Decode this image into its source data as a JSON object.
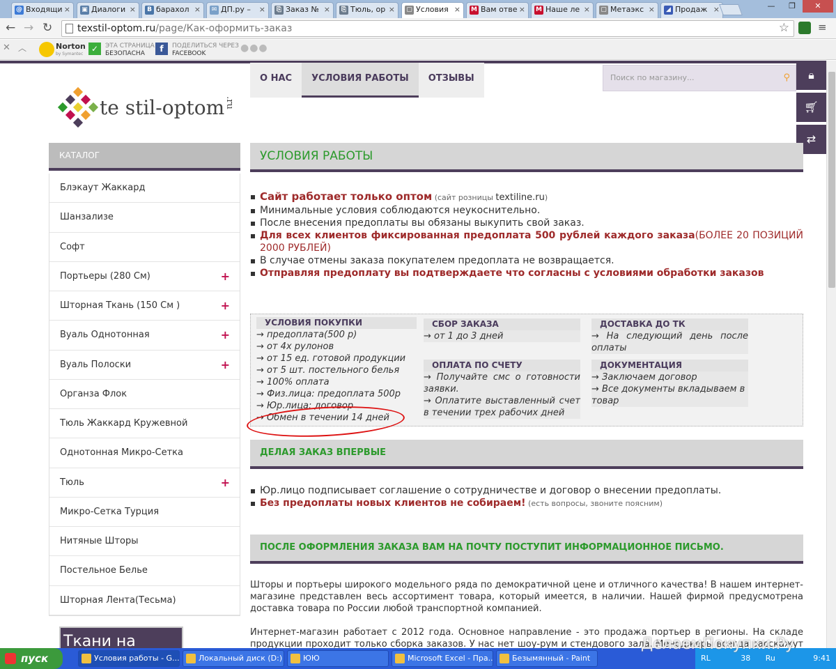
{
  "browser": {
    "tabs": [
      {
        "label": "Входящи",
        "fav": "@",
        "color": "#3d7bd6"
      },
      {
        "label": "Диалоги",
        "fav": "▣",
        "color": "#5b7fa8"
      },
      {
        "label": "барахол",
        "fav": "В",
        "color": "#4a76a8"
      },
      {
        "label": "ДП.ру –",
        "fav": "✉",
        "color": "#7aa0c8"
      },
      {
        "label": "Заказ №",
        "fav": "⎘",
        "color": "#6b7b8c"
      },
      {
        "label": "Тюль, ор",
        "fav": "⎘",
        "color": "#6b7b8c"
      },
      {
        "label": "Условия",
        "fav": "▢",
        "color": "#888888"
      },
      {
        "label": "Вам отве",
        "fav": "M",
        "color": "#c8102e"
      },
      {
        "label": "Наше ле",
        "fav": "M",
        "color": "#c8102e"
      },
      {
        "label": "Метаэкс",
        "fav": "▢",
        "color": "#888888"
      },
      {
        "label": "Продаж",
        "fav": "◢",
        "color": "#3a5bb5"
      }
    ],
    "active_tab_index": 6,
    "url_host": "texstil-optom.ru",
    "url_path": "/page/Как-оформить-заказ",
    "toolbar": {
      "norton_label": "Norton",
      "norton_sub": "by Symantec",
      "safe_line1": "ЭТА СТРАНИЦА",
      "safe_line2": "БЕЗОПАСНА",
      "share_line1": "ПОДЕЛИТЬСЯ ЧЕРЕЗ",
      "share_line2": "FACEBOOK"
    }
  },
  "site": {
    "logo_text": "te  stil-optom",
    "logo_suffix": ".ru",
    "nav": [
      {
        "label": "О НАС",
        "active": false
      },
      {
        "label": "УСЛОВИЯ РАБОТЫ",
        "active": true
      },
      {
        "label": "ОТЗЫВЫ",
        "active": false
      }
    ],
    "search_placeholder": "Поиск по магазину...",
    "catalog_title": "КАТАЛОГ",
    "catalog": [
      {
        "label": "Блэкаут Жаккард",
        "plus": false
      },
      {
        "label": "Шанзализе",
        "plus": false
      },
      {
        "label": "Софт",
        "plus": false
      },
      {
        "label": "Портьеры (280 См)",
        "plus": true
      },
      {
        "label": "Шторная Ткань (150 См )",
        "plus": true
      },
      {
        "label": "Вуаль Однотонная",
        "plus": true
      },
      {
        "label": "Вуаль Полоски",
        "plus": true
      },
      {
        "label": "Органза Флок",
        "plus": false
      },
      {
        "label": "Тюль Жаккард Кружевной",
        "plus": false
      },
      {
        "label": "Однотонная Микро-Сетка",
        "plus": false
      },
      {
        "label": "Тюль",
        "plus": true
      },
      {
        "label": "Микро-Сетка Турция",
        "plus": false
      },
      {
        "label": "Нитяные Шторы",
        "plus": false
      },
      {
        "label": "Постельное Белье",
        "plus": false
      },
      {
        "label": "Шторная Лента(Тесьма)",
        "plus": false
      }
    ],
    "banner_text": "Ткани на заказ"
  },
  "content": {
    "title": "УСЛОВИЯ РАБОТЫ",
    "rules": {
      "r1_bold": "Сайт работает только оптом",
      "r1_small": " (сайт розницы ",
      "r1_link": "textiline.ru",
      "r1_close": ")",
      "r2": "Минимальные условия соблюдаются неукоснительно.",
      "r3": "После внесения предоплаты вы обязаны выкупить свой заказ.",
      "r4_bold": "Для всех клиентов фиксированная предоплата 500 рублей каждого заказа",
      "r4_rest": "(БОЛЕЕ 20 ПОЗИЦИЙ 2000 РУБЛЕЙ)",
      "r5": "В случае отмены заказа покупателем предоплата не возвращается.",
      "r6_bold": "Отправляя предоплату вы подтверждаете что согласны с условиями обработки заказов"
    },
    "purchase_title": "УСЛОВИЯ ПОКУПКИ",
    "purchase_items": [
      "→ предоплата(500 р)",
      "→ от 4х рулонов",
      "→ от 15 ед. готовой продукции",
      "→ от 5 шт. постельного белья",
      "→ 100% оплата",
      "→ Физ.лица: предоплата 500р",
      "→ Юр.лица: договор",
      "→ Обмен в течении 14 дней"
    ],
    "assembly_title": "СБОР ЗАКАЗА",
    "assembly_text": "→ от 1 до 3 дней",
    "invoice_title": "ОПЛАТА ПО СЧЕТУ",
    "invoice_text1": "→ Получайте смс о готовности заявки.",
    "invoice_text2": "→ Оплатите выставленный счет в течении трех рабочих дней",
    "delivery_title": "ДОСТАВКА ДО ТК",
    "delivery_text": "→ На следующий день после оплаты",
    "docs_title": "ДОКУМЕНТАЦИЯ",
    "docs_text1": "→ Заключаем договор",
    "docs_text2": "→ Все документы вкладываем в товар",
    "first_title": "ДЕЛАЯ ЗАКАЗ ВПЕРВЫЕ",
    "first_1": "Юр.лицо подписывает соглашение о сотрудничестве и договор о внесении предоплаты.",
    "first_2_bold": "Без предоплаты новых клиентов не собираем!",
    "first_2_small": " (есть вопросы, звоните поясним)",
    "after_title": "ПОСЛЕ ОФОРМЛЕНИЯ ЗАКАЗА ВАМ НА ПОЧТУ ПОСТУПИТ ИНФОРМАЦИОННОЕ ПИСЬМО.",
    "para1": "Шторы и портьеры широкого модельного ряда по демократичной цене и отличного качества! В нашем интернет-магазине представлен весь ассортимент товара, который имеется, в наличии. Нашей фирмой предусмотрена доставка товара по России любой транспортной компанией.",
    "para2": "Интернет-магазин работает с 2012 года. Основное направление - это продажа портьер в регионы. На складе продукции проходит только сборка заказов. У нас нет шоу-рум и стендового зала. Менеджеры всегда расскажут вам о новых"
  },
  "taskbar": {
    "start": "пуск",
    "tasks": [
      {
        "label": "Условия работы - G...",
        "active": true
      },
      {
        "label": "Локальный диск (D:)",
        "active": false
      },
      {
        "label": "ЮЮ",
        "active": false
      },
      {
        "label": "Microsoft Excel - Пра...",
        "active": false
      },
      {
        "label": "Безымянный - Paint",
        "active": false
      }
    ],
    "lang": "RL",
    "tray_num": "38",
    "tray_lang": "Ru",
    "clock": "9:41",
    "watermark": "ДелаемПокупки.Ру"
  }
}
